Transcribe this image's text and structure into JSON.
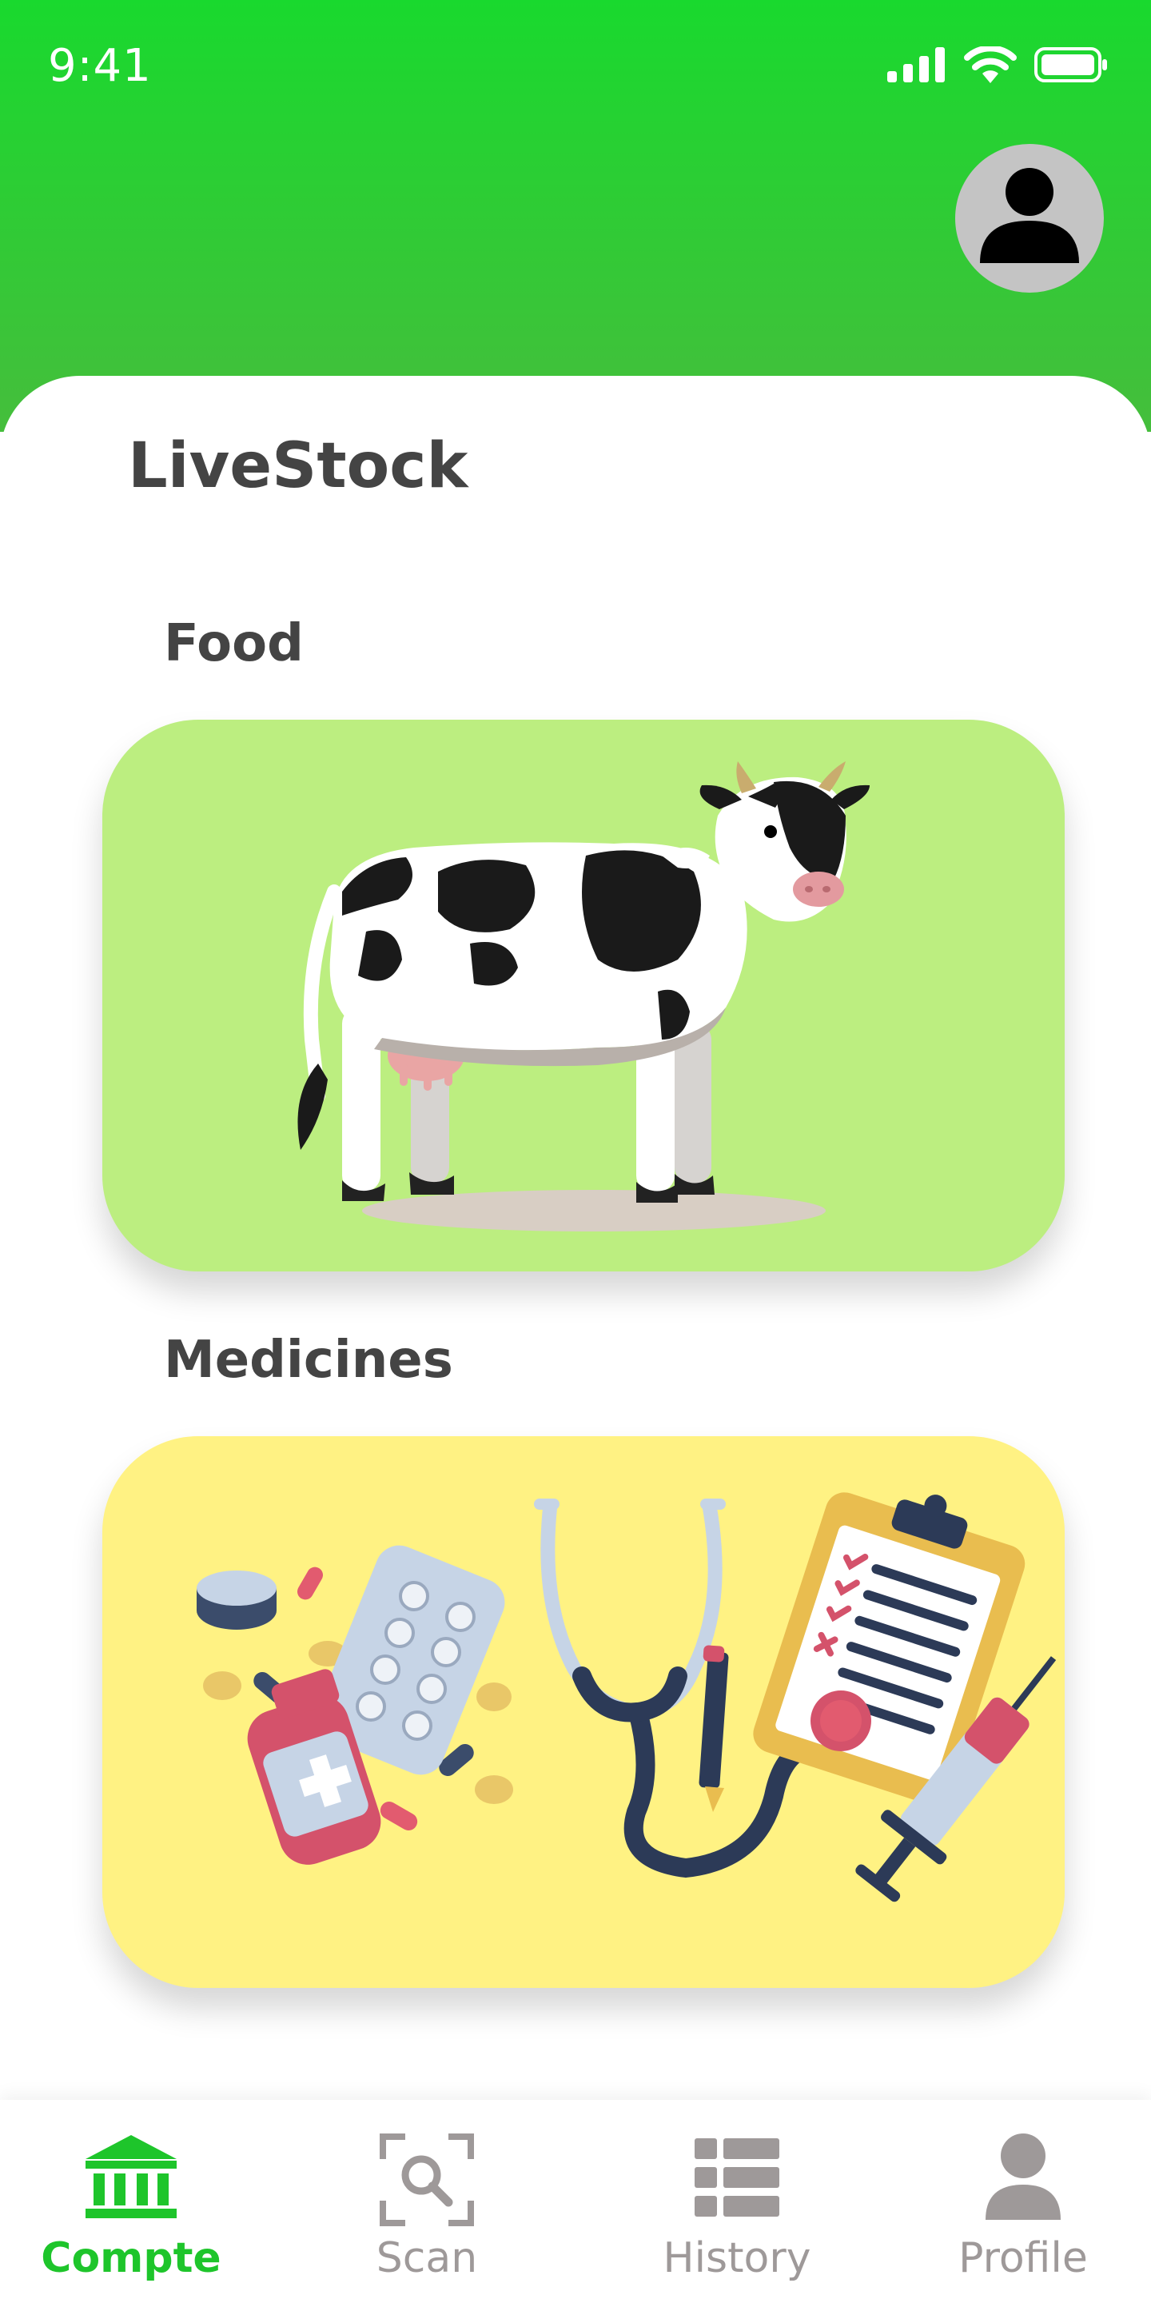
{
  "status_bar": {
    "time": "9:41"
  },
  "header": {
    "avatar_icon": "user-icon"
  },
  "page": {
    "title": "LiveStock"
  },
  "sections": [
    {
      "label": "Food",
      "illustration": "cow-illustration",
      "background": "#bcee80"
    },
    {
      "label": "Medicines",
      "illustration": "medical-supplies-illustration",
      "background": "#fff283"
    }
  ],
  "bottom_nav": {
    "active_color": "#1ec52b",
    "inactive_color": "#9e9999",
    "items": [
      {
        "label": "Compte",
        "icon": "bank-icon",
        "active": true
      },
      {
        "label": "Scan",
        "icon": "scan-icon",
        "active": false
      },
      {
        "label": "History",
        "icon": "list-icon",
        "active": false
      },
      {
        "label": "Profile",
        "icon": "user-icon",
        "active": false
      }
    ]
  }
}
